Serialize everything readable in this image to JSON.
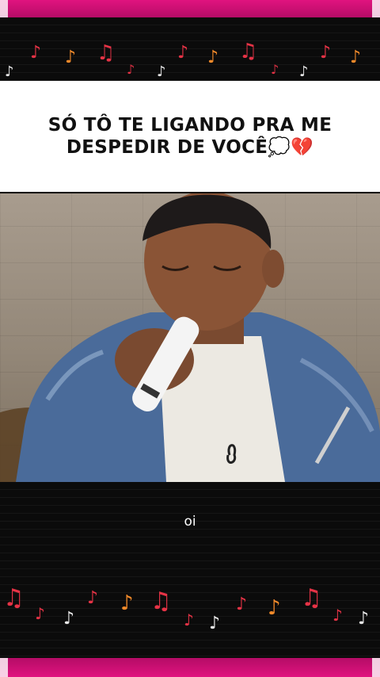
{
  "caption": {
    "line1": "SÓ TÔ TE LIGANDO PRA ME",
    "line2": "DESPEDIR DE VOCÊ",
    "emoji": "💭💔"
  },
  "video": {
    "scene": "singer-performance",
    "jacket_color": "#4a6b9a",
    "shirt_color": "#ece9e2",
    "microphone_color": "#f4f4f4"
  },
  "subtitle": {
    "text": "oi"
  },
  "theme": {
    "accent": "#e0137f",
    "note_red": "#e63346",
    "note_orange": "#f28a2a",
    "note_white": "#e8e8e8"
  },
  "decor": {
    "note_icon": "music-note-icon"
  }
}
